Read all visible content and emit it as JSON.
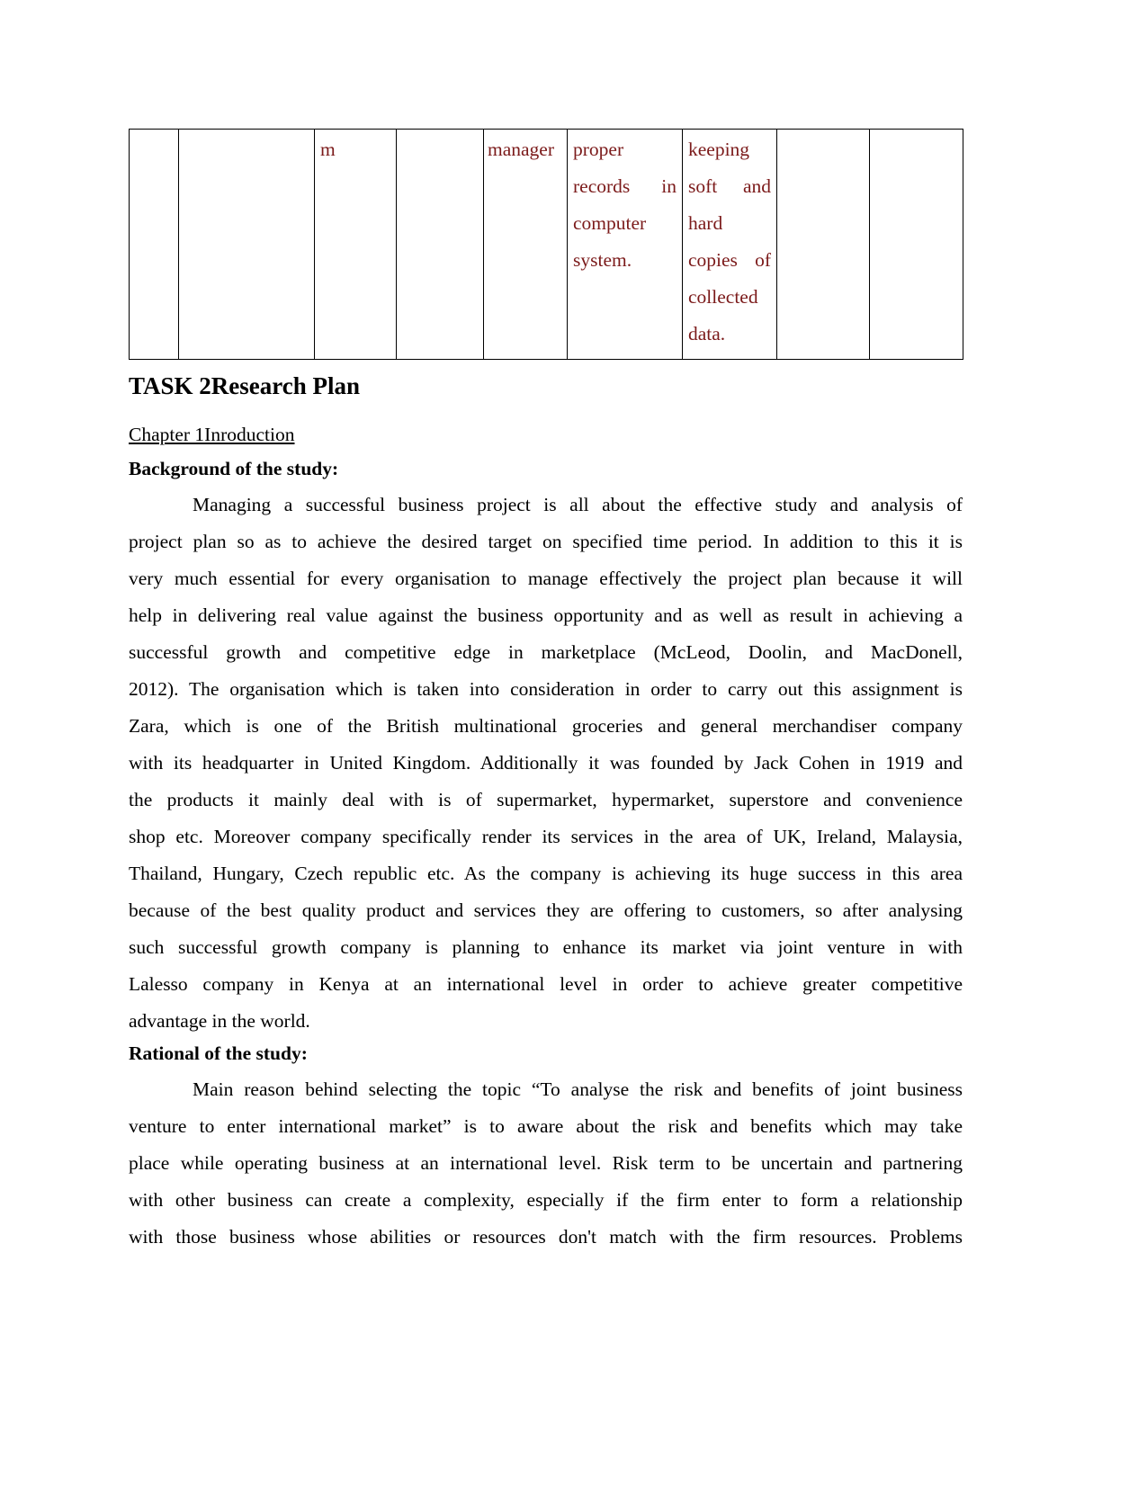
{
  "colors": {
    "table_text": "#7b1a1a",
    "body_text": "#000000"
  },
  "table": {
    "rows": [
      {
        "cells": [
          "",
          "",
          "m",
          "",
          "manager",
          "proper records in computer system.",
          "keeping soft and hard copies of collected data.",
          "",
          ""
        ]
      }
    ],
    "cell_lines": {
      "c6": [
        "proper",
        "records in",
        "computer",
        "system."
      ],
      "c7": [
        "keeping",
        "soft and",
        "hard",
        "copies of",
        "collected",
        "data."
      ]
    }
  },
  "task_title": "TASK 2Research Plan",
  "chapter_title": "Chapter 1Inroduction",
  "sections": [
    {
      "heading": "Background of the study:",
      "lines": [
        "Managing a successful business project is all about the effective study and analysis of",
        "project plan so as to achieve the desired target on specified time period. In addition to this it is",
        "very much essential for every organisation to manage effectively the project plan because it will",
        "help in delivering real value against the business opportunity and as well as result in achieving a",
        "successful growth and competitive edge in marketplace (McLeod,  Doolin, and MacDonell,",
        "2012).  The organisation which is taken into consideration in order to carry out this assignment is",
        "Zara, which is one of the British multinational groceries and general merchandiser company",
        "with its headquarter in United Kingdom. Additionally it was founded by Jack Cohen in 1919 and",
        "the products it mainly deal with is of supermarket, hypermarket, superstore and convenience",
        "shop etc. Moreover company specifically render its services in the area of UK, Ireland, Malaysia,",
        "Thailand, Hungary, Czech republic etc. As the company is achieving its huge success in this area",
        "because of the best quality product and services they are offering to customers, so after analysing",
        "such successful growth company is planning to enhance its market via joint venture in with",
        "Lalesso company in  Kenya at an international level in order to achieve greater competitive",
        "advantage in the world."
      ]
    },
    {
      "heading": "Rational of the study:",
      "lines": [
        "Main reason behind selecting the topic “To analyse the risk and benefits of joint business",
        "venture to enter international market” is to aware about the risk and benefits  which may take",
        "place while operating business at an international level. Risk term to be uncertain and partnering",
        "with other business can create a complexity, especially if the firm enter to form a relationship",
        "with those business whose abilities or resources don't match with the firm resources. Problems"
      ]
    }
  ]
}
